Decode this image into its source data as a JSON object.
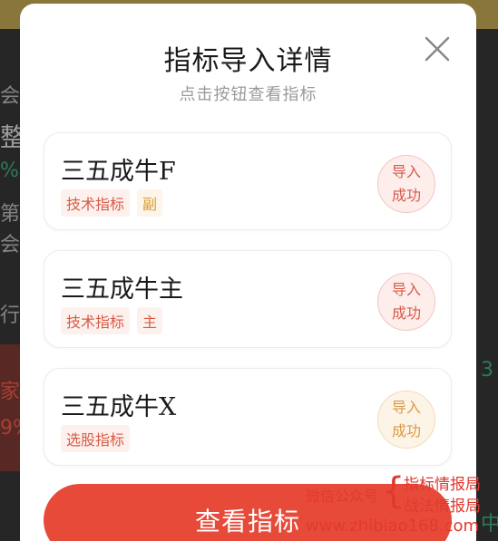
{
  "background_fragments": {
    "f1": "会",
    "f2": "整",
    "f3": "%",
    "f4": "第王",
    "f5": "会",
    "f6": "行业",
    "f7": "家",
    "f8": "9%",
    "f9": "3",
    "f10": "中"
  },
  "modal": {
    "title": "指标导入详情",
    "subtitle": "点击按钮查看指标",
    "close_icon": "close-icon"
  },
  "indicators": [
    {
      "name": "三五成牛F",
      "tags": [
        "技术指标",
        "副"
      ],
      "status_line1": "导入",
      "status_line2": "成功",
      "status_color": "#d9594a"
    },
    {
      "name": "三五成牛主",
      "tags": [
        "技术指标",
        "主"
      ],
      "status_line1": "导入",
      "status_line2": "成功",
      "status_color": "#d9594a"
    },
    {
      "name": "三五成牛X",
      "tags": [
        "选股指标"
      ],
      "status_line1": "导入",
      "status_line2": "成功",
      "status_color": "#d99a42"
    }
  ],
  "action": {
    "view_label": "查看指标"
  },
  "watermark": {
    "label": "微信公众号",
    "line1": "指标情报局",
    "line2": "战法情报局",
    "url": "www.zhibiao168.com"
  },
  "colors": {
    "accent": "#e84a3a",
    "tag_red": "#d85a45",
    "tag_orange": "#d89a35"
  }
}
